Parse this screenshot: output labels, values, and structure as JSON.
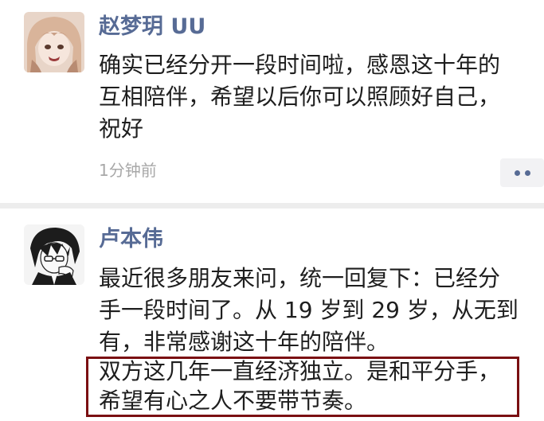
{
  "posts": [
    {
      "author": "赵梦玥 UU",
      "avatar_icon": "anime-girl-avatar-icon",
      "lines": [
        "确实已经分开一段时间啦，感恩这十年的",
        "互相陪伴，希望以后你可以照顾好自己，",
        "祝好"
      ],
      "timestamp": "1分钟前"
    },
    {
      "author": "卢本伟",
      "avatar_icon": "anime-boy-avatar-icon",
      "lines": [
        "最近很多朋友来问，统一回复下：已经分",
        "手一段时间了。从 19 岁到 29 岁，从无到",
        "有，非常感谢这十年的陪伴。",
        "双方这几年一直经济独立。是和平分手，",
        "希望有心之人不要带节奏。"
      ]
    }
  ],
  "colors": {
    "name": "#576b95",
    "body_text": "#1e1e1e",
    "timestamp": "#a8a8a8",
    "divider": "#ededed",
    "highlight_border": "#7a0f12"
  }
}
